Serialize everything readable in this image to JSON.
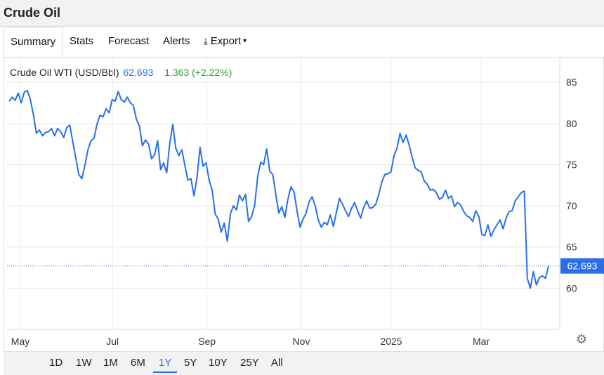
{
  "page": {
    "title": "Crude Oil"
  },
  "tabs": [
    {
      "label": "Summary"
    },
    {
      "label": "Stats"
    },
    {
      "label": "Forecast"
    },
    {
      "label": "Alerts"
    },
    {
      "label": "Export"
    }
  ],
  "active_tab": "Summary",
  "legend": {
    "series_name": "Crude Oil WTI (USD/Bbl)",
    "last_value": "62.693",
    "change": "1.363 (+2.22%)"
  },
  "ranges": [
    "1D",
    "1W",
    "1M",
    "6M",
    "1Y",
    "5Y",
    "10Y",
    "25Y",
    "All"
  ],
  "active_range": "1Y",
  "colors": {
    "line": "#2a6fe8",
    "change": "#2aa52a",
    "grid": "#e6e6e6",
    "badge": "#2a6fe8"
  },
  "icons": {
    "settings": "gear-icon",
    "export": "download-icon"
  },
  "chart_data": {
    "type": "line",
    "title": "",
    "xlabel": "",
    "ylabel": "",
    "ylim": [
      55,
      88
    ],
    "yticks": [
      60,
      65,
      70,
      75,
      80,
      85
    ],
    "xticks": [
      {
        "label": "May",
        "x": 2.5
      },
      {
        "label": "Jul",
        "x": 23
      },
      {
        "label": "Sep",
        "x": 44
      },
      {
        "label": "Nov",
        "x": 65
      },
      {
        "label": "2025",
        "x": 85
      },
      {
        "label": "Mar",
        "x": 105
      }
    ],
    "grid": true,
    "last_value_label": "62.693",
    "series": [
      {
        "name": "Crude Oil WTI (USD/Bbl)",
        "values": [
          82.7,
          83.2,
          82.8,
          83.7,
          82.5,
          83.8,
          84.0,
          82.9,
          81.1,
          78.8,
          79.2,
          78.5,
          78.9,
          79.0,
          79.4,
          78.5,
          79.4,
          79.0,
          78.3,
          79.5,
          79.8,
          77.8,
          75.8,
          73.8,
          73.3,
          74.9,
          76.8,
          77.9,
          78.2,
          79.9,
          81.0,
          80.8,
          81.8,
          81.3,
          82.9,
          82.7,
          83.9,
          82.9,
          82.6,
          83.2,
          82.5,
          82.2,
          80.5,
          79.7,
          77.3,
          78.0,
          77.5,
          75.7,
          76.2,
          77.9,
          74.4,
          75.2,
          74.0,
          77.6,
          79.9,
          77.0,
          76.1,
          76.8,
          74.9,
          73.1,
          73.3,
          71.2,
          73.4,
          77.1,
          74.8,
          75.2,
          73.1,
          71.9,
          69.0,
          68.4,
          66.8,
          67.9,
          65.7,
          69.0,
          70.0,
          69.5,
          71.3,
          70.6,
          71.4,
          68.1,
          68.7,
          70.0,
          73.5,
          75.3,
          75.0,
          76.9,
          74.2,
          73.8,
          71.4,
          69.1,
          69.9,
          68.6,
          70.8,
          72.3,
          71.7,
          69.4,
          67.4,
          68.4,
          69.1,
          70.5,
          71.1,
          70.0,
          68.3,
          67.4,
          68.0,
          67.7,
          68.9,
          67.5,
          69.2,
          70.9,
          70.2,
          69.4,
          68.7,
          69.7,
          70.4,
          69.4,
          68.5,
          69.8,
          70.6,
          69.7,
          69.8,
          70.2,
          71.4,
          72.9,
          73.8,
          73.9,
          74.1,
          76.1,
          77.0,
          78.8,
          77.7,
          78.6,
          77.4,
          75.9,
          74.6,
          74.3,
          74.1,
          73.0,
          72.6,
          71.9,
          72.0,
          71.6,
          70.8,
          71.0,
          71.9,
          70.9,
          71.2,
          69.9,
          70.4,
          70.1,
          69.3,
          68.8,
          68.6,
          68.1,
          69.4,
          68.7,
          66.5,
          66.4,
          67.7,
          66.3,
          67.1,
          67.7,
          68.3,
          67.2,
          68.5,
          69.3,
          69.4,
          70.6,
          71.1,
          71.6,
          71.8,
          61.2,
          60.0,
          62.0,
          60.4,
          61.3,
          61.5,
          61.2,
          62.7
        ]
      }
    ]
  }
}
